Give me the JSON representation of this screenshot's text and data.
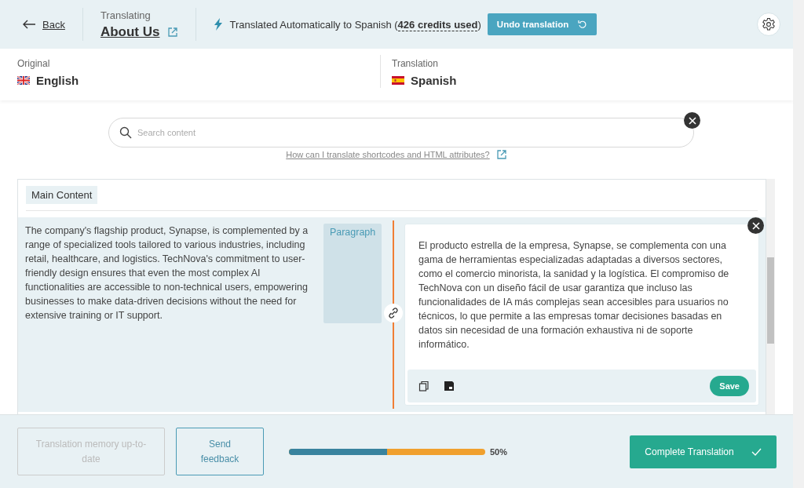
{
  "header": {
    "back": "Back",
    "context_label": "Translating",
    "page_title": "About Us",
    "status": "Translated Automatically to Spanish (**426 credits used**)",
    "undo_button": "Undo translation"
  },
  "languages": {
    "original": {
      "label": "Original",
      "name": "English",
      "kind": "uk"
    },
    "translation": {
      "label": "Translation",
      "name": "Spanish",
      "kind": "es"
    }
  },
  "search": {
    "placeholder": "Search content"
  },
  "help_link": "How can I translate shortcodes and HTML attributes?",
  "section": {
    "title": "Main Content",
    "segments": [
      {
        "source": "The company's flagship product, Synapse, is complemented by a range of specialized tools tailored to various industries, including retail, healthcare, and logistics. TechNova's commitment to user-friendly design ensures that even the most complex AI functionalities are accessible to non-technical users, empowering businesses to make data-driven decisions without the need for extensive training or IT support.",
        "type": "Paragraph",
        "translation": "El producto estrella de la empresa, Synapse, se complementa con una gama de herramientas especializadas adaptadas a diversos sectores, como el comercio minorista, la sanidad y la logística. El compromiso de TechNova con un diseño fácil de usar garantiza que incluso las funcionalidades de IA más complejas sean accesibles para usuarios no técnicos, lo que permite a las empresas tomar decisiones basadas en datos sin necesidad de una formación exhaustiva ni de soporte informático.",
        "save": "Save",
        "active": true
      }
    ]
  },
  "footer": {
    "memory_button": {
      "label": "Translation memory up-to-date",
      "disabled": true
    },
    "feedback_button": {
      "label": "Send feedback",
      "disabled": false
    },
    "progress": {
      "level": 0.5,
      "reading": "50%"
    },
    "complete_button": "Complete Translation"
  }
}
